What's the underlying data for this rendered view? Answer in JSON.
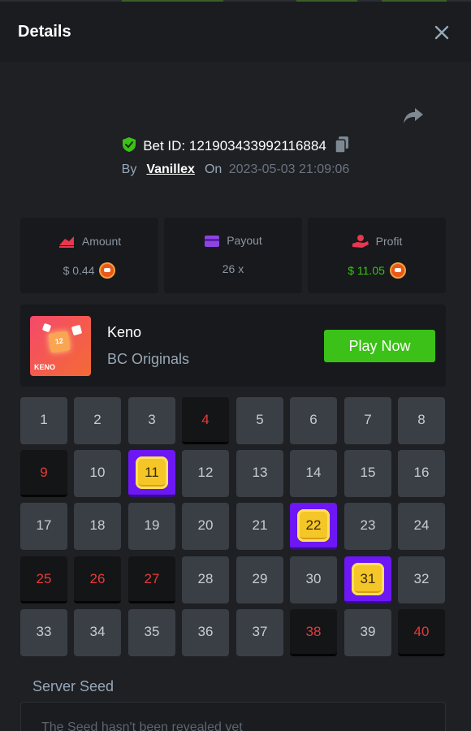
{
  "header": {
    "title": "Details"
  },
  "bet": {
    "id_label": "Bet ID: 121903433992116884",
    "by_label": "By",
    "user": "Vanillex",
    "on_label": "On",
    "datetime": "2023-05-03 21:09:06"
  },
  "stats": {
    "amount": {
      "label": "Amount",
      "value": "$ 0.44"
    },
    "payout": {
      "label": "Payout",
      "value": "26 x"
    },
    "profit": {
      "label": "Profit",
      "value": "$ 11.05"
    }
  },
  "game": {
    "name": "Keno",
    "provider": "BC Originals",
    "thumb_text": "KENO",
    "thumb_number": "12",
    "play_label": "Play Now"
  },
  "keno": {
    "numbers": [
      "1",
      "2",
      "3",
      "4",
      "5",
      "6",
      "7",
      "8",
      "9",
      "10",
      "11",
      "12",
      "13",
      "14",
      "15",
      "16",
      "17",
      "18",
      "19",
      "20",
      "21",
      "22",
      "23",
      "24",
      "25",
      "26",
      "27",
      "28",
      "29",
      "30",
      "31",
      "32",
      "33",
      "34",
      "35",
      "36",
      "37",
      "38",
      "39",
      "40"
    ],
    "hits": [
      11,
      22,
      31
    ],
    "misses": [
      4,
      9,
      25,
      26,
      27,
      38,
      40
    ]
  },
  "seed": {
    "label": "Server Seed",
    "value": "The Seed hasn't been revealed yet"
  },
  "colors": {
    "accent_green": "#3bc117",
    "hit_purple": "#6d17f5",
    "miss_red": "#e53a3a"
  },
  "icons": [
    "close-icon",
    "share-icon",
    "shield-check-icon",
    "copy-icon",
    "amount-icon",
    "payout-icon",
    "profit-icon",
    "shib-coin-icon"
  ]
}
